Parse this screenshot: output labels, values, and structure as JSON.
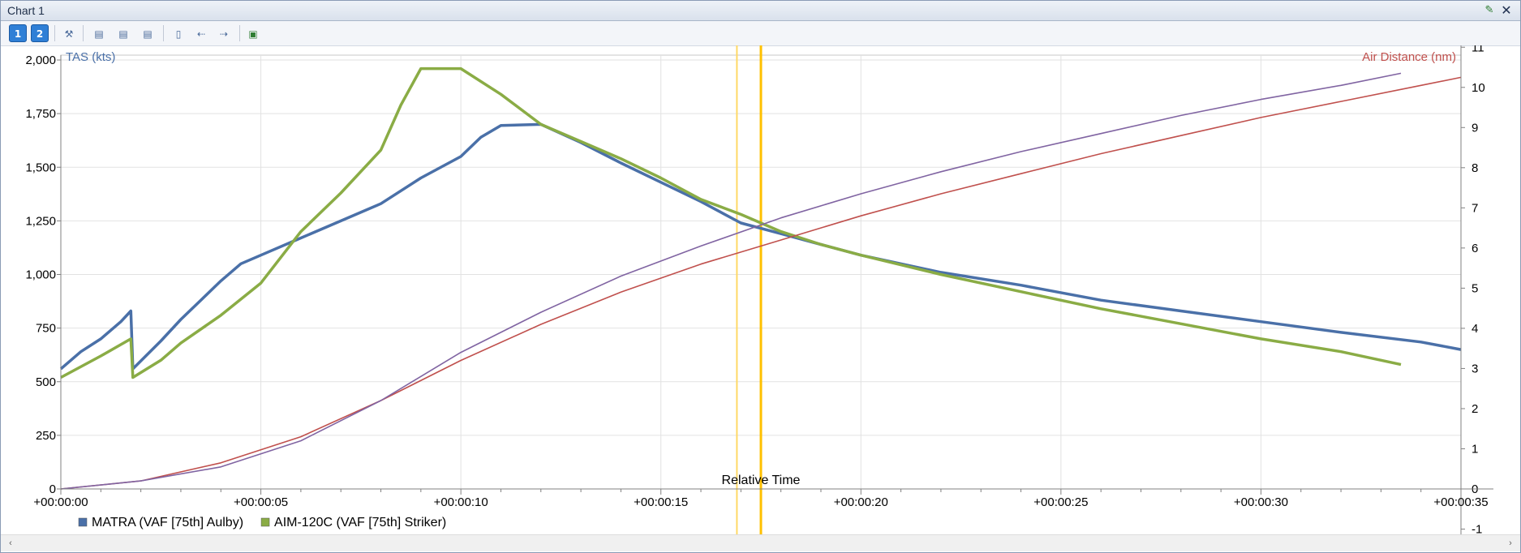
{
  "window": {
    "title": "Chart 1"
  },
  "toolbar": {
    "btn1_label": "1",
    "btn2_label": "2"
  },
  "chart_data": {
    "type": "line",
    "xlabel": "Relative Time",
    "x_ticks": [
      "+00:00:00",
      "+00:00:05",
      "+00:00:10",
      "+00:00:15",
      "+00:00:20",
      "+00:00:25",
      "+00:00:30",
      "+00:00:35"
    ],
    "xlim": [
      0,
      35
    ],
    "left_axis": {
      "label": "TAS (kts)",
      "ticks": [
        "0",
        "250",
        "500",
        "750",
        "1,000",
        "1,250",
        "1,500",
        "1,750",
        "2,000"
      ],
      "ylim": [
        0,
        2000
      ]
    },
    "right_axis": {
      "label": "Air Distance (nm)",
      "ticks": [
        "-1",
        "0",
        "1",
        "2",
        "3",
        "4",
        "5",
        "6",
        "7",
        "8",
        "9",
        "10",
        "11"
      ],
      "ylim": [
        0,
        10.5
      ]
    },
    "cursor_times": [
      16.9,
      17.5
    ],
    "grid": true,
    "legend_position": "bottom-left",
    "series": [
      {
        "name": "MATRA (VAF [75th] Aulby)",
        "color": "#4a70a8",
        "axis": "left",
        "x": [
          0,
          0.5,
          1,
          1.5,
          1.75,
          1.8,
          2.5,
          3,
          3.5,
          4,
          4.5,
          5,
          6,
          7,
          8,
          9,
          10,
          10.5,
          11,
          12,
          13,
          14,
          15,
          16,
          17,
          18,
          19,
          20,
          22,
          24,
          26,
          28,
          30,
          32,
          34,
          35
        ],
        "y": [
          560,
          640,
          700,
          780,
          830,
          560,
          690,
          790,
          880,
          970,
          1050,
          1090,
          1170,
          1250,
          1330,
          1450,
          1550,
          1640,
          1695,
          1700,
          1615,
          1520,
          1430,
          1340,
          1240,
          1190,
          1140,
          1090,
          1010,
          950,
          880,
          830,
          780,
          730,
          685,
          650
        ]
      },
      {
        "name": "AIM-120C (VAF [75th] Striker)",
        "color": "#8aac45",
        "axis": "left",
        "x": [
          0,
          1,
          1.75,
          1.8,
          2.5,
          3,
          4,
          5,
          6,
          7,
          8,
          8.5,
          9,
          10,
          11,
          12,
          13,
          14,
          15,
          16,
          17,
          18,
          19,
          20,
          22,
          24,
          26,
          28,
          30,
          32,
          33.5
        ],
        "y": [
          520,
          620,
          700,
          520,
          600,
          680,
          810,
          960,
          1200,
          1380,
          1580,
          1790,
          1960,
          1960,
          1840,
          1700,
          1620,
          1540,
          1450,
          1350,
          1280,
          1200,
          1140,
          1090,
          1000,
          920,
          840,
          770,
          700,
          640,
          580
        ]
      },
      {
        "name": "",
        "color": "#c0504d",
        "axis": "right",
        "x": [
          0,
          2,
          4,
          6,
          8,
          10,
          12,
          14,
          16,
          18,
          20,
          22,
          24,
          26,
          28,
          30,
          32,
          34,
          35
        ],
        "y": [
          0,
          0.2,
          0.65,
          1.3,
          2.2,
          3.2,
          4.1,
          4.9,
          5.6,
          6.2,
          6.8,
          7.35,
          7.85,
          8.35,
          8.8,
          9.25,
          9.65,
          10.05,
          10.25
        ]
      },
      {
        "name": "",
        "color": "#8064a2",
        "axis": "right",
        "x": [
          0,
          2,
          4,
          6,
          8,
          10,
          12,
          14,
          16,
          18,
          20,
          22,
          24,
          26,
          28,
          30,
          32,
          33.5
        ],
        "y": [
          0,
          0.2,
          0.55,
          1.2,
          2.2,
          3.4,
          4.4,
          5.3,
          6.05,
          6.75,
          7.35,
          7.9,
          8.4,
          8.85,
          9.3,
          9.7,
          10.05,
          10.35
        ]
      }
    ]
  },
  "scrollbar": {
    "left_arrow": "‹",
    "right_arrow": "›"
  }
}
